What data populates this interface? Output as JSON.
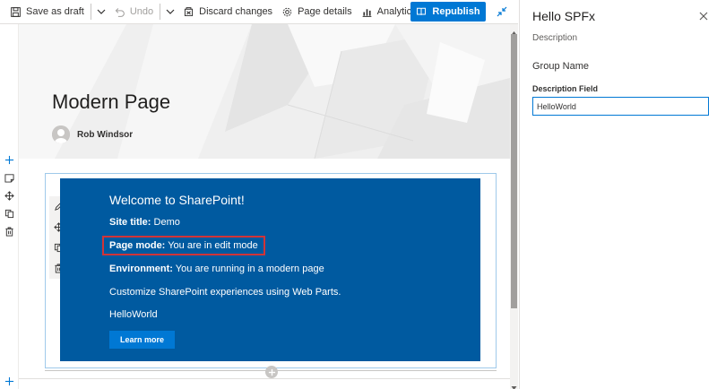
{
  "toolbar": {
    "save_draft_label": "Save as draft",
    "undo_label": "Undo",
    "discard_label": "Discard changes",
    "page_details_label": "Page details",
    "analytics_label": "Analytics",
    "republish_label": "Republish"
  },
  "page": {
    "title": "Modern Page",
    "author": "Rob Windsor"
  },
  "webpart": {
    "welcome": "Welcome to SharePoint!",
    "site_title_label": "Site title:",
    "site_title_value": "Demo",
    "page_mode_label": "Page mode:",
    "page_mode_value": "You are in edit mode",
    "environment_label": "Environment:",
    "environment_value": "You are running in a modern page",
    "customize_text": "Customize SharePoint experiences using Web Parts.",
    "description_text": "HelloWorld",
    "learn_more_label": "Learn more"
  },
  "property_pane": {
    "title": "Hello SPFx",
    "description": "Description",
    "group_name": "Group Name",
    "field_label": "Description Field",
    "field_value": "HelloWorld"
  },
  "colors": {
    "accent": "#0078d4",
    "webpart_bg": "#005aa0",
    "highlight": "#d13438"
  }
}
